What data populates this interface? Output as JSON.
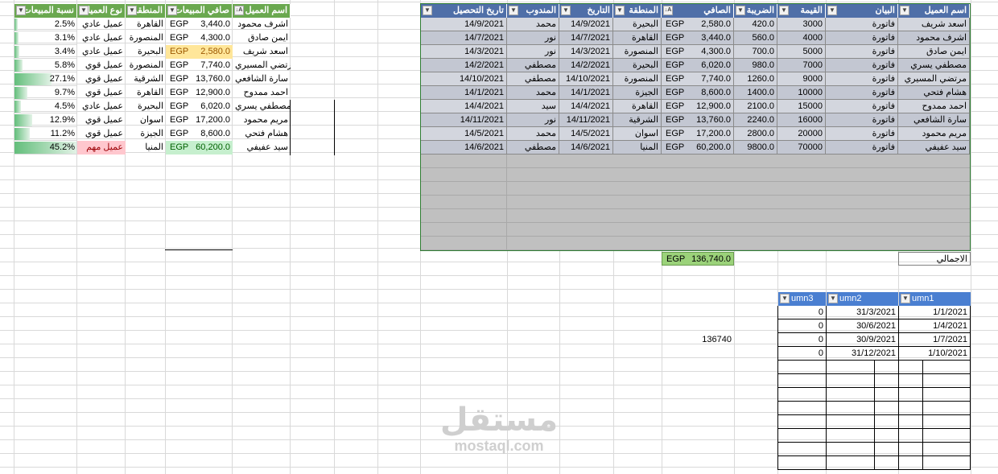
{
  "left_table": {
    "headers": [
      "اسم العميل",
      "صافي المبيعات",
      "المنطقة",
      "نوع العميل",
      "نسبة المبيعات"
    ],
    "rows": [
      {
        "name": "اشرف محمود",
        "currency": "EGP",
        "net": "3,440.0",
        "region": "القاهرة",
        "type": "عميل عادي",
        "pct": "2.5%"
      },
      {
        "name": "ايمن صادق",
        "currency": "EGP",
        "net": "4,300.0",
        "region": "المنصورة",
        "type": "عميل عادي",
        "pct": "3.1%"
      },
      {
        "name": "اسعد شريف",
        "currency": "EGP",
        "net": "2,580.0",
        "region": "البحيرة",
        "type": "عميل عادي",
        "pct": "3.4%"
      },
      {
        "name": "مرتضي المسيري",
        "currency": "EGP",
        "net": "7,740.0",
        "region": "المنصورة",
        "type": "عميل قوي",
        "pct": "5.8%"
      },
      {
        "name": "سارة الشافعي",
        "currency": "EGP",
        "net": "13,760.0",
        "region": "الشرقية",
        "type": "عميل قوي",
        "pct": "27.1%"
      },
      {
        "name": "احمد ممدوح",
        "currency": "EGP",
        "net": "12,900.0",
        "region": "القاهرة",
        "type": "عميل قوي",
        "pct": "9.7%"
      },
      {
        "name": "مصطفي يسري",
        "currency": "EGP",
        "net": "6,020.0",
        "region": "البحيرة",
        "type": "عميل عادي",
        "pct": "4.5%"
      },
      {
        "name": "مريم محمود",
        "currency": "EGP",
        "net": "17,200.0",
        "region": "اسوان",
        "type": "عميل قوي",
        "pct": "12.9%"
      },
      {
        "name": "هشام فتحي",
        "currency": "EGP",
        "net": "8,600.0",
        "region": "الجيزة",
        "type": "عميل قوي",
        "pct": "11.2%"
      },
      {
        "name": "سيد عفيفي",
        "currency": "EGP",
        "net": "60,200.0",
        "region": "المنيا",
        "type": "عميل مهم",
        "pct": "45.2%"
      }
    ]
  },
  "main_table": {
    "headers": [
      "اسم العميل",
      "البيان",
      "القيمة",
      "الضريبة",
      "الصافي",
      "المنطقة",
      "التاريخ",
      "المندوب",
      "تاريخ التحصيل"
    ],
    "rows": [
      {
        "name": "اسعد شريف",
        "desc": "فاتورة",
        "value": "3000",
        "tax": "420.0",
        "currency": "EGP",
        "net": "2,580.0",
        "region": "البحيرة",
        "date": "14/9/2021",
        "rep": "محمد",
        "collect": "14/9/2021"
      },
      {
        "name": "اشرف محمود",
        "desc": "فاتورة",
        "value": "4000",
        "tax": "560.0",
        "currency": "EGP",
        "net": "3,440.0",
        "region": "القاهرة",
        "date": "14/7/2021",
        "rep": "نور",
        "collect": "14/7/2021"
      },
      {
        "name": "ايمن صادق",
        "desc": "فاتورة",
        "value": "5000",
        "tax": "700.0",
        "currency": "EGP",
        "net": "4,300.0",
        "region": "المنصورة",
        "date": "14/3/2021",
        "rep": "نور",
        "collect": "14/3/2021"
      },
      {
        "name": "مصطفي يسري",
        "desc": "فاتورة",
        "value": "7000",
        "tax": "980.0",
        "currency": "EGP",
        "net": "6,020.0",
        "region": "البحيرة",
        "date": "14/2/2021",
        "rep": "مصطفي",
        "collect": "14/2/2021"
      },
      {
        "name": "مرتضي المسيري",
        "desc": "فاتورة",
        "value": "9000",
        "tax": "1260.0",
        "currency": "EGP",
        "net": "7,740.0",
        "region": "المنصورة",
        "date": "14/10/2021",
        "rep": "مصطفي",
        "collect": "14/10/2021"
      },
      {
        "name": "هشام فتحي",
        "desc": "فاتورة",
        "value": "10000",
        "tax": "1400.0",
        "currency": "EGP",
        "net": "8,600.0",
        "region": "الجيزة",
        "date": "14/1/2021",
        "rep": "محمد",
        "collect": "14/1/2021"
      },
      {
        "name": "احمد ممدوح",
        "desc": "فاتورة",
        "value": "15000",
        "tax": "2100.0",
        "currency": "EGP",
        "net": "12,900.0",
        "region": "القاهرة",
        "date": "14/4/2021",
        "rep": "سيد",
        "collect": "14/4/2021"
      },
      {
        "name": "سارة الشافعي",
        "desc": "فاتورة",
        "value": "16000",
        "tax": "2240.0",
        "currency": "EGP",
        "net": "13,760.0",
        "region": "الشرقية",
        "date": "14/11/2021",
        "rep": "نور",
        "collect": "14/11/2021"
      },
      {
        "name": "مريم محمود",
        "desc": "فاتورة",
        "value": "20000",
        "tax": "2800.0",
        "currency": "EGP",
        "net": "17,200.0",
        "region": "اسوان",
        "date": "14/5/2021",
        "rep": "محمد",
        "collect": "14/5/2021"
      },
      {
        "name": "سيد عفيفي",
        "desc": "فاتورة",
        "value": "70000",
        "tax": "9800.0",
        "currency": "EGP",
        "net": "60,200.0",
        "region": "المنيا",
        "date": "14/6/2021",
        "rep": "مصطفي",
        "collect": "14/6/2021"
      }
    ],
    "total_label": "الاجمالي",
    "total_currency": "EGP",
    "total_value": "136,740.0"
  },
  "small_table": {
    "headers": [
      "umn1",
      "umn2",
      "umn3"
    ],
    "rows": [
      {
        "c1": "1/1/2021",
        "c2": "31/3/2021",
        "c3": "0"
      },
      {
        "c1": "1/4/2021",
        "c2": "30/6/2021",
        "c3": "0"
      },
      {
        "c1": "1/7/2021",
        "c2": "30/9/2021",
        "c3": "0"
      },
      {
        "c1": "1/10/2021",
        "c2": "31/12/2021",
        "c3": "0"
      }
    ]
  },
  "standalone_value": "136740",
  "watermark": {
    "arabic": "مستقل",
    "latin": "mostaql.com"
  },
  "colors": {
    "green_header": "#6aa84f",
    "blue_header": "#4f6fa8",
    "light_blue_header": "#4a7fd1",
    "row_gray": "#c9ccd6",
    "highlight_yellow": "#ffe699",
    "highlight_green": "#c6efce",
    "highlight_red": "#ffc7ce"
  }
}
